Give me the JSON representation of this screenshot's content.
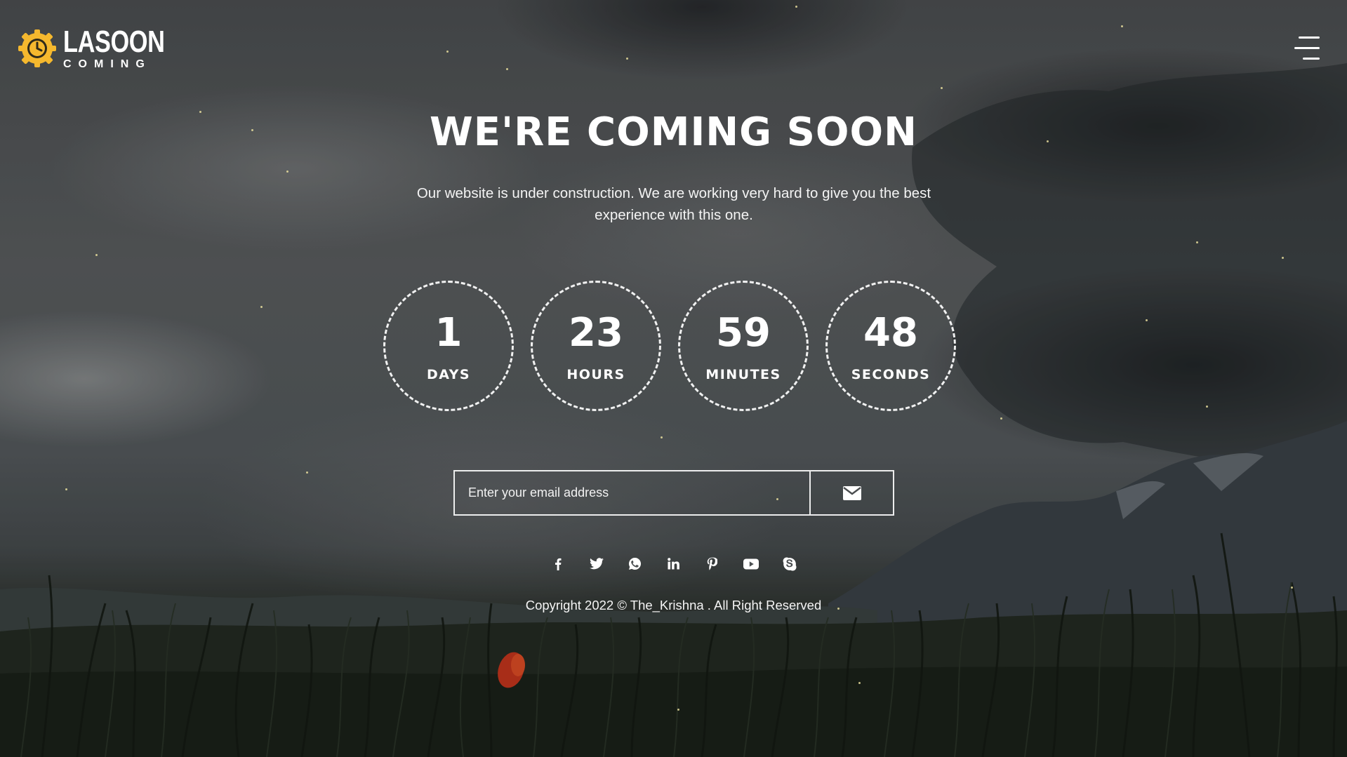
{
  "brand": {
    "name": "LASOON",
    "tagline": "COMING",
    "accent_color": "#f5b82e",
    "logo_icon": "gear-clock-icon"
  },
  "nav": {
    "menu_icon": "hamburger-menu-icon"
  },
  "hero": {
    "title": "WE'RE COMING SOON",
    "description": "Our website is under construction. We are working very hard to give you the best experience with this one."
  },
  "countdown": [
    {
      "value": "1",
      "label": "DAYS"
    },
    {
      "value": "23",
      "label": "HOURS"
    },
    {
      "value": "59",
      "label": "MINUTES"
    },
    {
      "value": "48",
      "label": "SECONDS"
    }
  ],
  "subscribe": {
    "placeholder": "Enter your email address",
    "button_icon": "envelope-icon"
  },
  "socials": [
    {
      "name": "facebook",
      "icon": "facebook-icon"
    },
    {
      "name": "twitter",
      "icon": "twitter-icon"
    },
    {
      "name": "whatsapp",
      "icon": "whatsapp-icon"
    },
    {
      "name": "linkedin",
      "icon": "linkedin-icon"
    },
    {
      "name": "pinterest",
      "icon": "pinterest-icon"
    },
    {
      "name": "youtube",
      "icon": "youtube-icon"
    },
    {
      "name": "skype",
      "icon": "skype-icon"
    }
  ],
  "footer": {
    "copyright": "Copyright 2022 © The_Krishna . All Right Reserved"
  }
}
